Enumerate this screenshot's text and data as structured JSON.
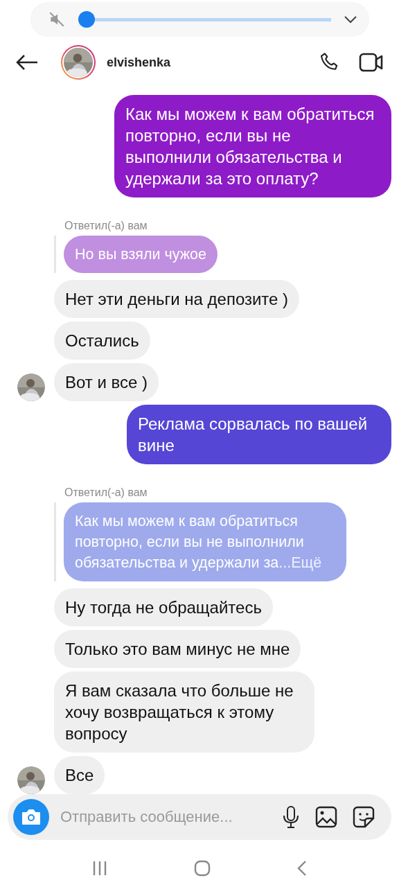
{
  "volume_panel": {
    "muted": true,
    "level": 0.0
  },
  "header": {
    "username": "elvishenka"
  },
  "messages": [
    {
      "kind": "sent",
      "text": "Как мы можем к вам обратиться повторно, если вы не выполнили обязательства и удержали за это оплату?",
      "color": "#8e1bc8"
    },
    {
      "kind": "reply_label",
      "text": "Ответил(-а) вам"
    },
    {
      "kind": "quote",
      "text": "Но вы взяли чужое",
      "color": "#c08fe0"
    },
    {
      "kind": "received",
      "text": "Нет эти деньги на депозите )",
      "avatar": false
    },
    {
      "kind": "received",
      "text": "Остались",
      "avatar": false
    },
    {
      "kind": "received",
      "text": "Вот и все )",
      "avatar": true
    },
    {
      "kind": "sent",
      "text": "Реклама сорвалась по вашей вине",
      "color": "#5546d6"
    },
    {
      "kind": "reply_label",
      "text": "Ответил(-а) вам"
    },
    {
      "kind": "quote",
      "text": "Как мы можем к вам обратиться повторно, если вы не выполнили обязательства и удержали за",
      "more": "...Ещё",
      "color": "#9eaaec"
    },
    {
      "kind": "received",
      "text": "Ну тогда не обращайтесь",
      "avatar": false
    },
    {
      "kind": "received",
      "text": "Только это вам минус не мне",
      "avatar": false
    },
    {
      "kind": "received",
      "text": "Я вам сказала что больше не хочу возвращаться к этому вопросу",
      "avatar": false
    },
    {
      "kind": "received",
      "text": "Все",
      "avatar": true
    }
  ],
  "composer": {
    "placeholder": "Отправить сообщение..."
  }
}
